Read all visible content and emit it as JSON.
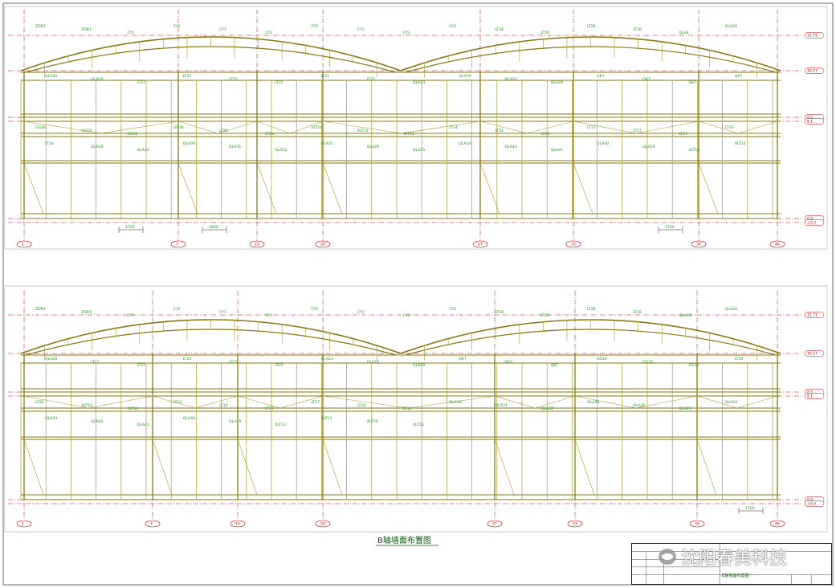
{
  "drawing": {
    "caption": "B轴墙面布置图",
    "colors": {
      "frame": "#8a7a12",
      "frame_light": "#a89a30",
      "label": "#12a012",
      "axis": "#cc0000",
      "border": "#6a6a6a"
    },
    "upper_elevation": {
      "labels": [
        "ZDB1",
        "ZDB1",
        "CY1",
        "CY2",
        "CY1",
        "CY2",
        "CY1",
        "CY1",
        "CY2",
        "CY2",
        "LT26",
        "LT26",
        "LT28",
        "LT28",
        "QLA4",
        "QLA20",
        "QLA20",
        "QLA20",
        "LT27",
        "LT27",
        "LT21",
        "LT21",
        "LT21",
        "LT21",
        "QLA23",
        "QLA20",
        "QLA20",
        "QLA20",
        "QK7",
        "QK7",
        "QK7",
        "QK7",
        "GG16",
        "GG16",
        "GG16",
        "GG16",
        "LT20",
        "LT20",
        "XLT14",
        "XLT14",
        "XLT14",
        "LT14",
        "LT14",
        "LT14",
        "LT17",
        "LT17",
        "LT17",
        "LT16",
        "LT16",
        "QLA20",
        "QLA20",
        "QLA30",
        "QLA31",
        "QLA32",
        "QLA31",
        "QLA26",
        "QLA25",
        "QLA24",
        "QLA43",
        "QLA41",
        "QLA40",
        "QLA29",
        "XLT13",
        "XLT13"
      ],
      "dimensions": [
        "1700",
        "2800",
        "1700"
      ],
      "elevations": [
        "11.71",
        "10.27",
        "8.5",
        "8.1",
        "0.9",
        "±0.0"
      ],
      "axis_tags": [
        "1",
        "7",
        "13",
        "20",
        "27",
        "33",
        "39",
        "46"
      ]
    },
    "lower_elevation": {
      "labels": [
        "ZDB1",
        "ZDB1",
        "CY1",
        "CY2",
        "CY1",
        "CY2",
        "CY1",
        "CY1",
        "CY2",
        "CY2",
        "LT26",
        "LT26",
        "LT28",
        "LT28",
        "QLA44",
        "QLA20",
        "QLA20",
        "LT27",
        "LT27",
        "LT21",
        "LT21",
        "LT21",
        "QLA23",
        "QLA20",
        "QLA20",
        "QK7",
        "QK7",
        "QK7",
        "GG16",
        "GG16",
        "GG16",
        "LT20",
        "LT20",
        "XLT14",
        "XLT14",
        "LT14",
        "LT14",
        "LT17",
        "LT17",
        "LT16",
        "LT16",
        "QLA30",
        "QLA31",
        "QLA32",
        "QLA33",
        "QLA26",
        "QLA25",
        "QLA24",
        "QLA43",
        "QLA42",
        "QLA41",
        "QLA40",
        "QLA29",
        "XLT13",
        "XLT13",
        "XLT16",
        "XLT16"
      ],
      "dimensions": [
        "1700"
      ],
      "elevations": [
        "11.71",
        "10.27",
        "8.5",
        "8.1",
        "0.9",
        "±0.0"
      ],
      "axis_tags": [
        "1",
        "7",
        "13",
        "20",
        "27",
        "33",
        "39",
        "46"
      ]
    }
  },
  "title_block": {
    "drawing_name": "B轴墙面布置图一"
  },
  "watermark": {
    "icon": "wechat-icon",
    "text": "沈阳春美科技"
  }
}
